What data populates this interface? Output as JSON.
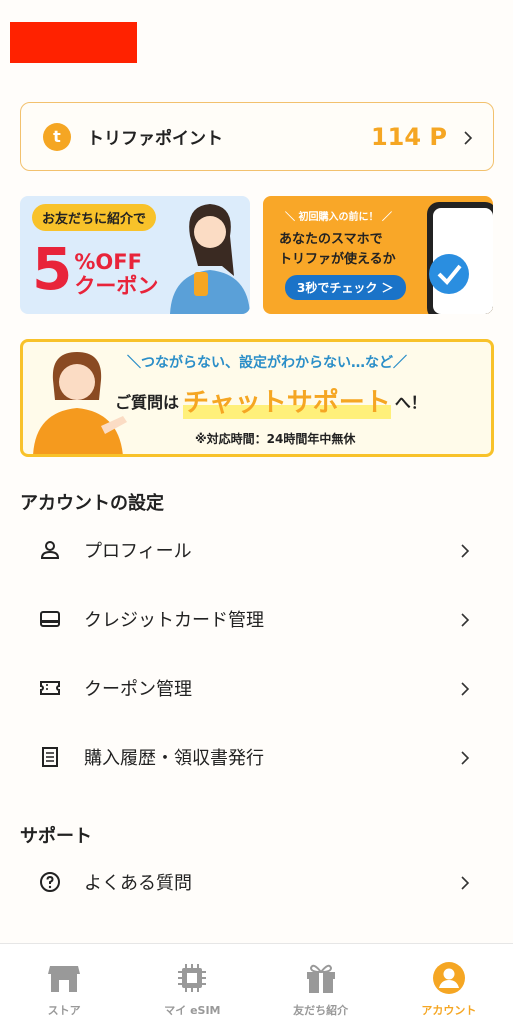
{
  "points": {
    "label": "トリファポイント",
    "value": "114 P",
    "badge": "t"
  },
  "banner_referral": {
    "tag": "お友だちに紹介で",
    "big_number": "5",
    "line1": "%OFF",
    "line2": "クーポン"
  },
  "banner_check": {
    "top": "＼ 初回購入の前に！ ／",
    "line1": "あなたのスマホで",
    "line2": "トリファが使えるか",
    "button": "3秒でチェック ＞"
  },
  "banner_chat": {
    "line1": "＼つながらない、設定がわからない…など／",
    "pre": "ご質問は",
    "main": "チャットサポート",
    "post": "へ！",
    "hours": "※対応時間：24時間年中無休"
  },
  "account_section": {
    "title": "アカウントの設定",
    "items": [
      {
        "label": "プロフィール",
        "icon": "person-icon"
      },
      {
        "label": "クレジットカード管理",
        "icon": "credit-card-icon"
      },
      {
        "label": "クーポン管理",
        "icon": "ticket-icon"
      },
      {
        "label": "購入履歴・領収書発行",
        "icon": "receipt-icon"
      }
    ]
  },
  "support_section": {
    "title": "サポート",
    "items": [
      {
        "label": "よくある質問",
        "icon": "help-circle-icon"
      }
    ]
  },
  "nav": {
    "items": [
      {
        "label": "ストア",
        "icon": "store-icon",
        "active": false
      },
      {
        "label": "マイ eSIM",
        "icon": "chip-icon",
        "active": false
      },
      {
        "label": "友だち紹介",
        "icon": "gift-icon",
        "active": false
      },
      {
        "label": "アカウント",
        "icon": "account-icon",
        "active": true
      }
    ]
  },
  "colors": {
    "accent": "#f5a623",
    "redacted": "#ff2200",
    "inactive": "#999999"
  }
}
